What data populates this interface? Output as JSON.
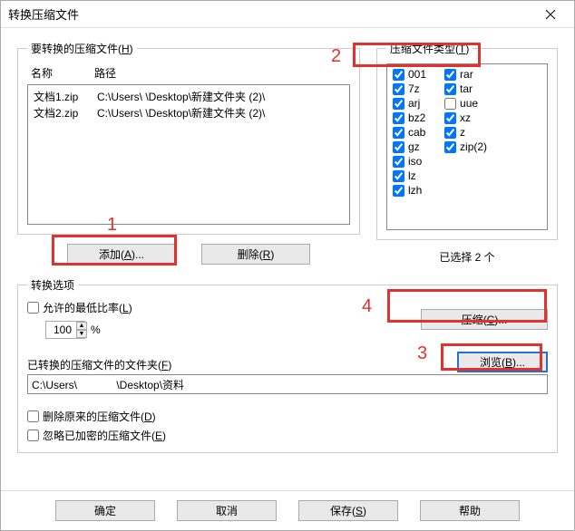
{
  "window": {
    "title": "转换压缩文件"
  },
  "files_section": {
    "legend_pre": "要转换的压缩文件(",
    "legend_u": "H",
    "legend_post": ")",
    "col_name": "名称",
    "col_path": "路径",
    "rows": [
      {
        "name": "文档1.zip",
        "path": "C:\\Users\\            \\Desktop\\新建文件夹 (2)\\"
      },
      {
        "name": "文档2.zip",
        "path": "C:\\Users\\            \\Desktop\\新建文件夹 (2)\\"
      }
    ],
    "add_pre": "添加(",
    "add_u": "A",
    "add_post": ")...",
    "del_pre": "删除(",
    "del_u": "R",
    "del_post": ")"
  },
  "types_section": {
    "legend_pre": "压缩文件类型(",
    "legend_u": "T",
    "legend_post": ")",
    "col1": [
      {
        "label": "001",
        "checked": true
      },
      {
        "label": "7z",
        "checked": true
      },
      {
        "label": "arj",
        "checked": true
      },
      {
        "label": "bz2",
        "checked": true
      },
      {
        "label": "cab",
        "checked": true
      },
      {
        "label": "gz",
        "checked": true
      },
      {
        "label": "iso",
        "checked": true
      },
      {
        "label": "lz",
        "checked": true
      },
      {
        "label": "lzh",
        "checked": true
      }
    ],
    "col2": [
      {
        "label": "rar",
        "checked": true
      },
      {
        "label": "tar",
        "checked": true
      },
      {
        "label": "uue",
        "checked": false
      },
      {
        "label": "xz",
        "checked": true
      },
      {
        "label": "z",
        "checked": true
      },
      {
        "label": "zip(2)",
        "checked": true
      }
    ],
    "selected_text": "已选择 2 个"
  },
  "options_section": {
    "legend": "转换选项",
    "min_ratio_pre": "允许的最低比率(",
    "min_ratio_u": "L",
    "min_ratio_post": ")",
    "min_ratio_value": "100",
    "pct": "%",
    "compress_pre": "压缩(",
    "compress_u": "C",
    "compress_post": ")...",
    "folder_pre": "已转换的压缩文件的文件夹(",
    "folder_u": "F",
    "folder_post": ")",
    "folder_value": "C:\\Users\\             \\Desktop\\资料",
    "browse_pre": "浏览(",
    "browse_u": "B",
    "browse_post": ")...",
    "del_orig_pre": "删除原来的压缩文件(",
    "del_orig_u": "D",
    "del_orig_post": ")",
    "ignore_enc_pre": "忽略已加密的压缩文件(",
    "ignore_enc_u": "E",
    "ignore_enc_post": ")"
  },
  "footer": {
    "ok": "确定",
    "cancel": "取消",
    "save_pre": "保存(",
    "save_u": "S",
    "save_post": ")",
    "help": "帮助"
  },
  "annotations": {
    "n1": "1",
    "n2": "2",
    "n3": "3",
    "n4": "4"
  }
}
